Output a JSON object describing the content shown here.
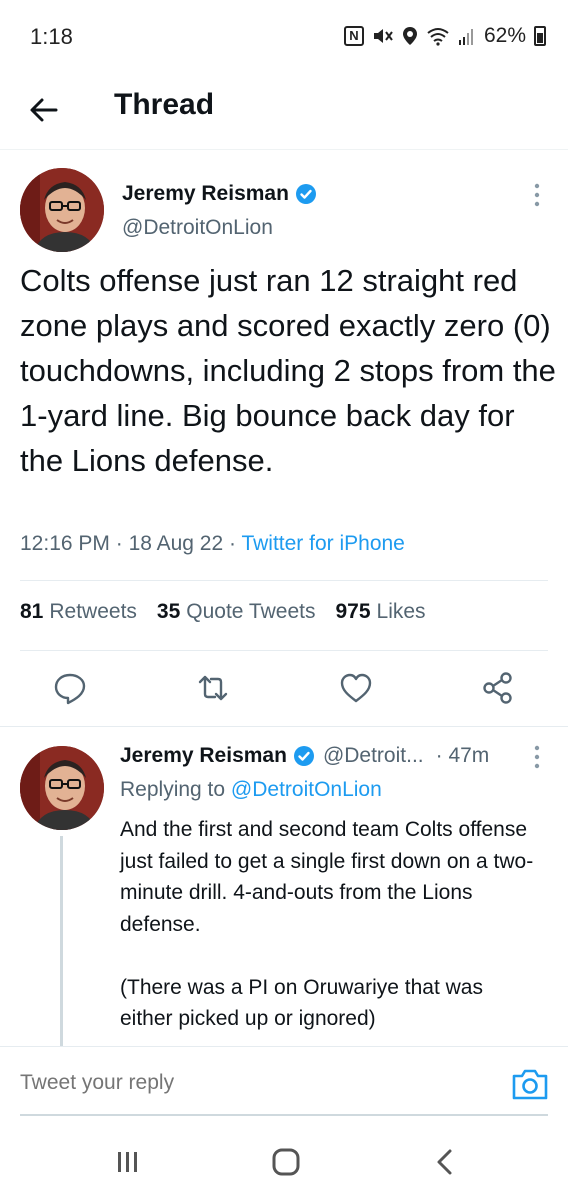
{
  "status_bar": {
    "time": "1:18",
    "battery": "62%",
    "icons": [
      "nfc-icon",
      "mute-icon",
      "location-icon",
      "wifi-icon",
      "signal-icon",
      "battery-icon"
    ]
  },
  "header": {
    "title": "Thread",
    "back_icon": "arrow-left-icon"
  },
  "main_tweet": {
    "author_name": "Jeremy Reisman",
    "handle": "@DetroitOnLion",
    "text": "Colts offense just ran 12 straight red zone plays and scored exactly zero (0) touchdowns, including 2 stops from the 1-yard line. Big bounce back day for the Lions defense.",
    "time": "12:16 PM",
    "date": "18 Aug 22",
    "source": "Twitter for iPhone",
    "stats": {
      "retweets_count": "81",
      "retweets_label": "Retweets",
      "quotes_count": "35",
      "quotes_label": "Quote Tweets",
      "likes_count": "975",
      "likes_label": "Likes"
    },
    "actions": [
      "reply-icon",
      "retweet-icon",
      "like-icon",
      "share-icon"
    ]
  },
  "reply_tweet": {
    "author_name": "Jeremy Reisman",
    "handle": "@Detroit...",
    "age": "· 47m",
    "replying_prefix": "Replying to",
    "replying_to": "@DetroitOnLion",
    "text": "And the first and second team Colts offense just failed to get a single first down on a two-minute drill. 4-and-outs from the Lions defense.\n\n(There was a PI on Oruwariye that was either picked up or ignored)"
  },
  "compose": {
    "placeholder": "Tweet your reply"
  },
  "colors": {
    "accent": "#1d9bf0",
    "text_primary": "#0f1419",
    "text_secondary": "#536471"
  }
}
